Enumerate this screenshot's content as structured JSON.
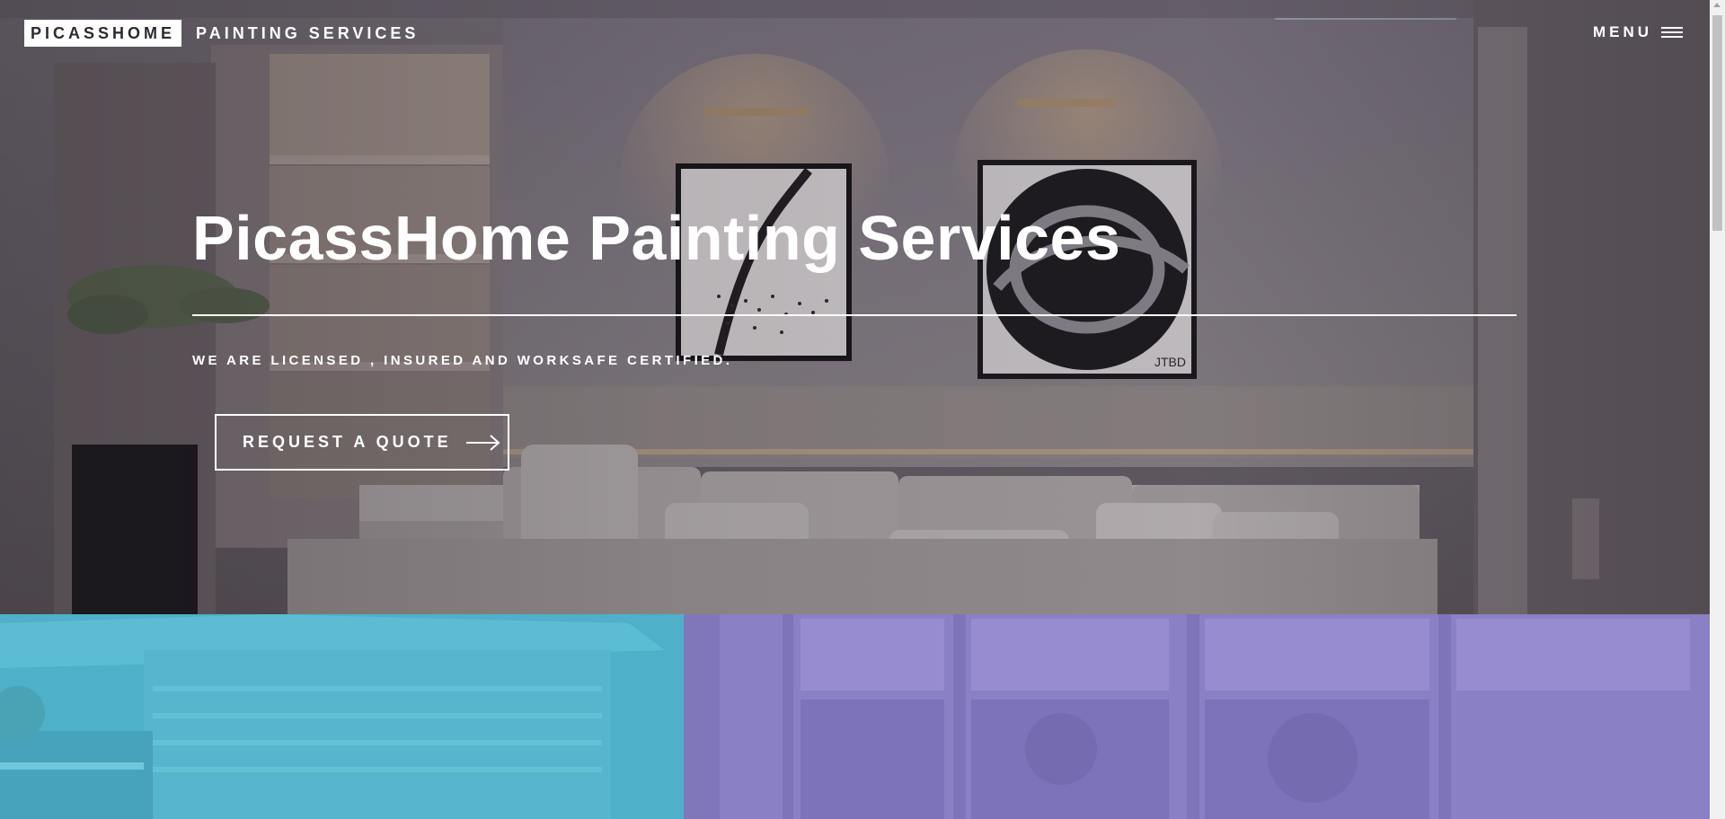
{
  "header": {
    "logo_primary": "PICASSHOME",
    "logo_secondary": "PAINTING SERVICES",
    "menu_label": "MENU",
    "menu_icon": "hamburger-icon"
  },
  "hero": {
    "title": "PicassHome Painting Services",
    "tagline": "WE ARE LICENSED , INSURED AND WORKSAFE CERTIFIED.",
    "cta_label": "REQUEST A QUOTE",
    "cta_icon": "arrow-right-icon",
    "artwork_signature": "JTBD"
  },
  "panels": {
    "left_color": "#4fb0c9",
    "right_color": "#8a80c6"
  },
  "colors": {
    "text": "#ffffff",
    "logo_box": "#ffffff",
    "logo_text": "#2e2a30"
  }
}
